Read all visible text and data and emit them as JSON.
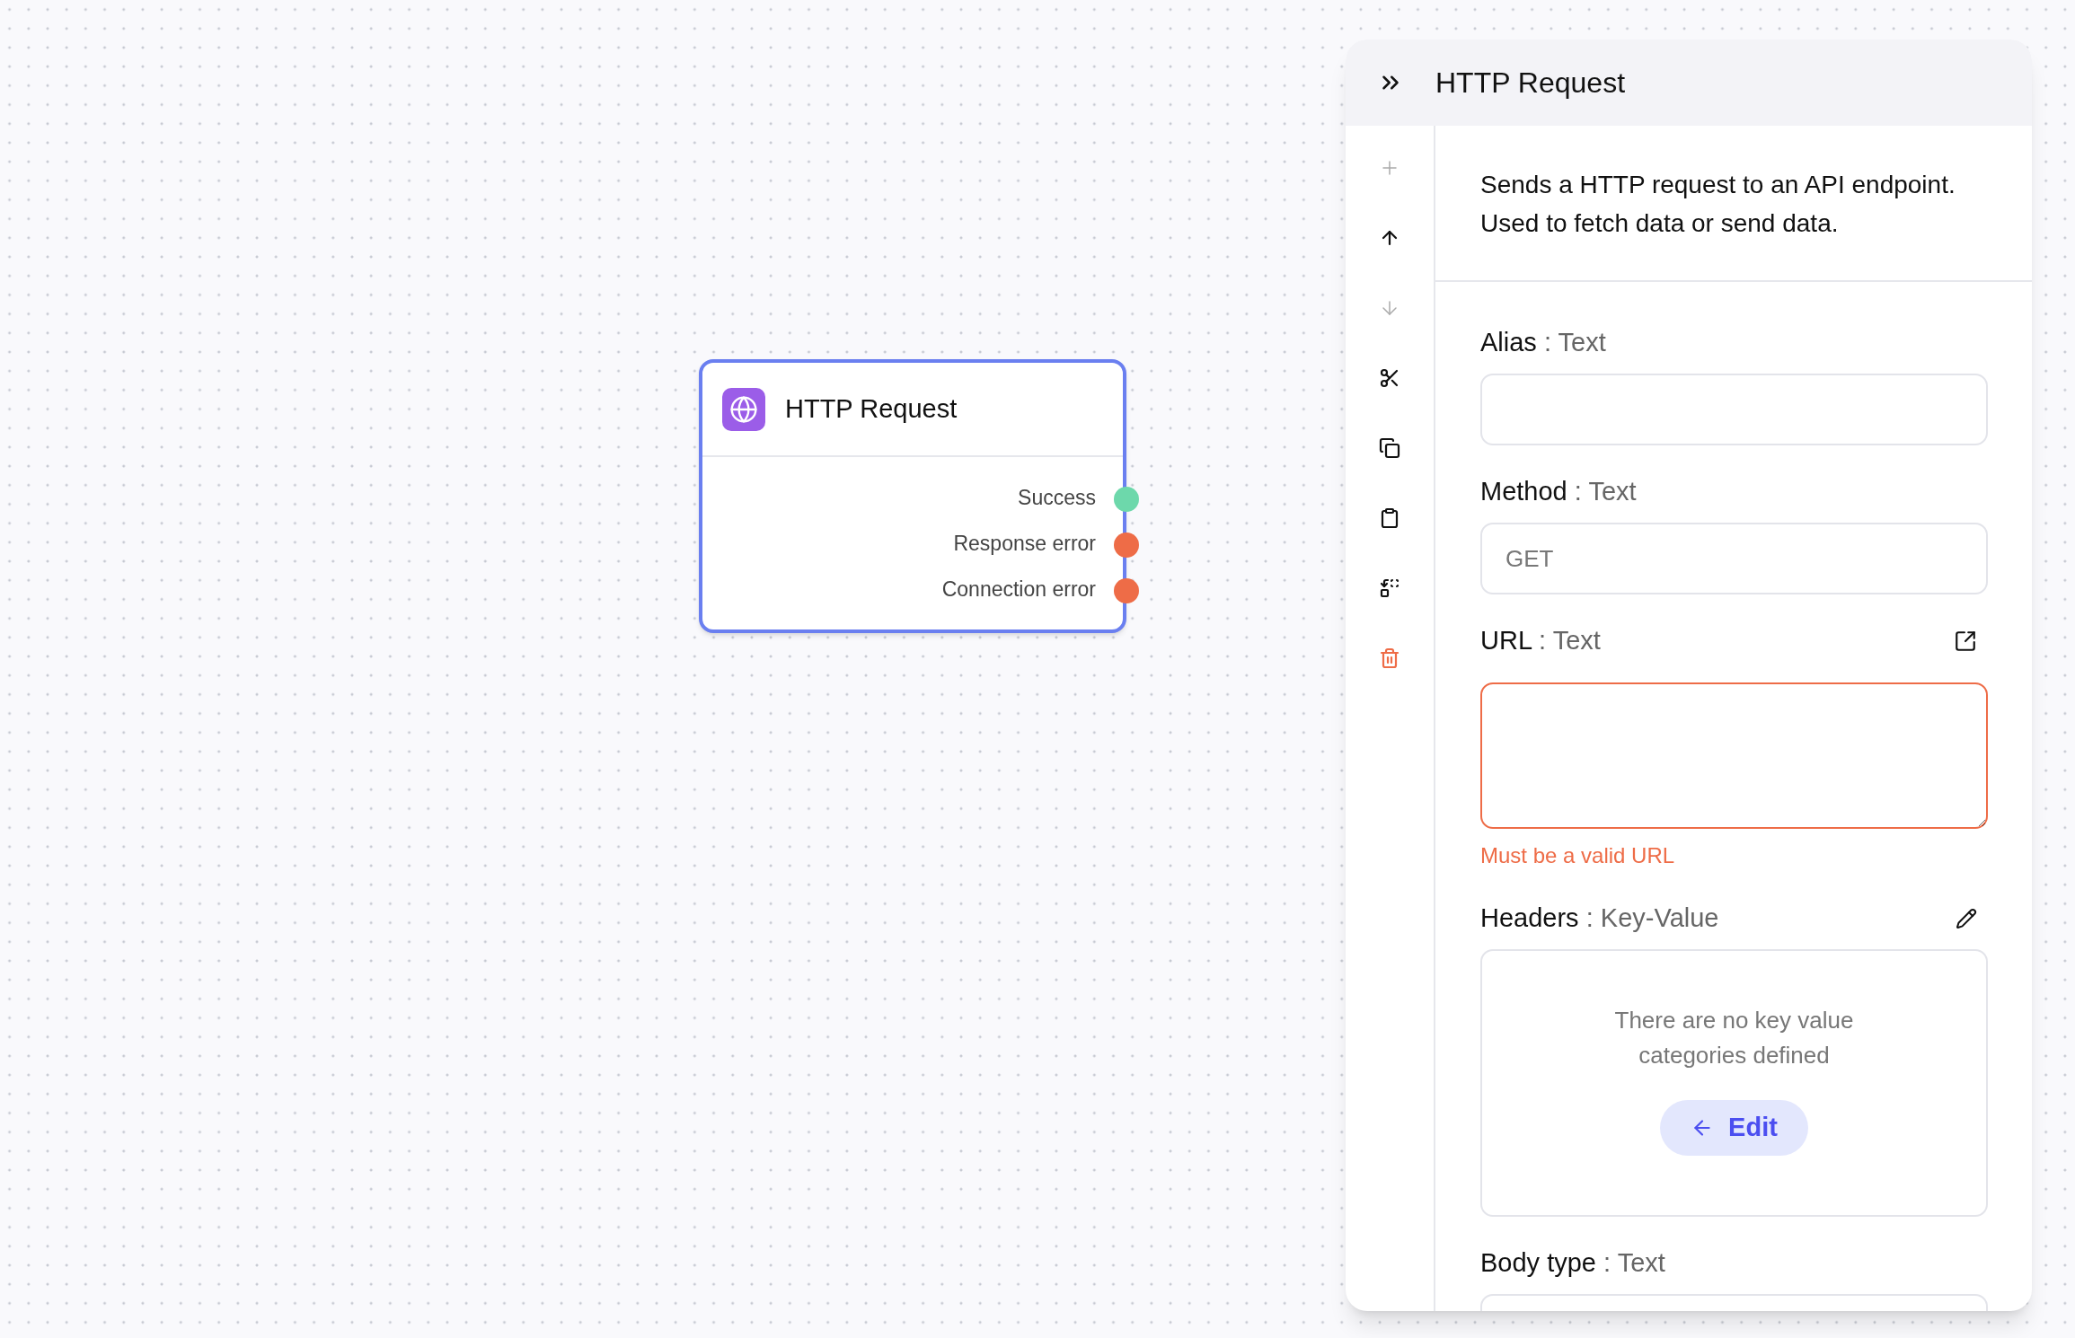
{
  "node": {
    "title": "HTTP Request",
    "selected": true,
    "outputs": [
      {
        "label": "Success",
        "color": "#6dd8ab"
      },
      {
        "label": "Response error",
        "color": "#ee6c47"
      },
      {
        "label": "Connection error",
        "color": "#ee6c47"
      }
    ]
  },
  "panel": {
    "title": "HTTP Request",
    "toolbar": [
      {
        "kind": "add",
        "disabled": true
      },
      {
        "kind": "move_up",
        "disabled": false
      },
      {
        "kind": "move_down",
        "disabled": true
      },
      {
        "kind": "cut",
        "disabled": false
      },
      {
        "kind": "copy",
        "disabled": false
      },
      {
        "kind": "paste",
        "disabled": false
      },
      {
        "kind": "replace",
        "disabled": false
      },
      {
        "kind": "delete",
        "disabled": false
      }
    ],
    "description": "Sends a HTTP request to an API endpoint. Used to fetch data or send data.",
    "fields": [
      {
        "kind": "input",
        "label": "Alias",
        "separator": ":",
        "type": "Text"
      },
      {
        "kind": "input",
        "label": "Method",
        "separator": ":",
        "type": "Text",
        "placeholder": "GET"
      },
      {
        "kind": "textarea",
        "label": "URL",
        "separator": ":",
        "type": "Text",
        "action": {
          "kind": "open"
        },
        "error": "Must be a valid URL"
      },
      {
        "kind": "key_value",
        "label": "Headers",
        "separator": ":",
        "type": "Key-Value",
        "action": {
          "kind": "edit"
        },
        "empty_message": "There are no key value categories defined",
        "button": "Edit"
      },
      {
        "kind": "input",
        "label": "Body type",
        "separator": ":",
        "type": "Text"
      }
    ]
  }
}
